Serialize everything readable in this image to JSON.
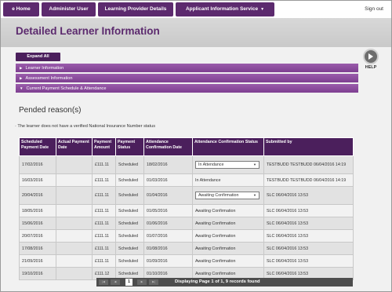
{
  "nav": {
    "tabs": [
      "e Home",
      "Administer User",
      "Learning Provider Details",
      "Applicant Information Service"
    ],
    "signout": "Sign out"
  },
  "page": {
    "title": "Detailed Learner Information"
  },
  "expand_all": "Expand All",
  "help": "HELP",
  "accordion": [
    "Learner Information",
    "Assessment Information",
    "Current Payment Schedule & Attendance"
  ],
  "pended": {
    "heading": "Pended reason(s)",
    "notice": "The learner does not have a verified National Insurance Number status"
  },
  "table": {
    "headers": [
      "Scheduled Payment Date",
      "Actual Payment Date",
      "Payment Amount",
      "Payment Status",
      "Attendance Confirmation Date",
      "Attendance Confirmation Status",
      "Submitted by"
    ],
    "rows": [
      {
        "sched": "17/02/2016",
        "actual": "",
        "amount": "£111.11",
        "status": "Scheduled",
        "conf_date": "18/02/2016",
        "conf_status": "In Attendance",
        "select": true,
        "by": "TESTBUDD TESTBUDD 06/04/2016 14:19"
      },
      {
        "sched": "16/03/2016",
        "actual": "",
        "amount": "£111.11",
        "status": "Scheduled",
        "conf_date": "01/03/2016",
        "conf_status": "In Attendance",
        "select": false,
        "by": "TESTBUDD TESTBUDD 06/04/2016 14:19"
      },
      {
        "sched": "20/04/2016",
        "actual": "",
        "amount": "£111.11",
        "status": "Scheduled",
        "conf_date": "01/04/2016",
        "conf_status": "Awaiting Confirmation",
        "select": true,
        "by": "SLC 06/04/2016 13:53"
      },
      {
        "sched": "18/05/2016",
        "actual": "",
        "amount": "£111.11",
        "status": "Scheduled",
        "conf_date": "01/05/2016",
        "conf_status": "Awaiting Confirmation",
        "select": false,
        "by": "SLC 06/04/2016 13:53"
      },
      {
        "sched": "15/06/2016",
        "actual": "",
        "amount": "£111.11",
        "status": "Scheduled",
        "conf_date": "01/06/2016",
        "conf_status": "Awaiting Confirmation",
        "select": false,
        "by": "SLC 06/04/2016 13:53"
      },
      {
        "sched": "20/07/2016",
        "actual": "",
        "amount": "£111.11",
        "status": "Scheduled",
        "conf_date": "01/07/2016",
        "conf_status": "Awaiting Confirmation",
        "select": false,
        "by": "SLC 06/04/2016 13:53"
      },
      {
        "sched": "17/08/2016",
        "actual": "",
        "amount": "£111.11",
        "status": "Scheduled",
        "conf_date": "01/08/2016",
        "conf_status": "Awaiting Confirmation",
        "select": false,
        "by": "SLC 06/04/2016 13:53"
      },
      {
        "sched": "21/09/2016",
        "actual": "",
        "amount": "£111.11",
        "status": "Scheduled",
        "conf_date": "01/09/2016",
        "conf_status": "Awaiting Confirmation",
        "select": false,
        "by": "SLC 06/04/2016 13:53"
      },
      {
        "sched": "19/10/2016",
        "actual": "",
        "amount": "£111.12",
        "status": "Scheduled",
        "conf_date": "01/10/2016",
        "conf_status": "Awaiting Confirmation",
        "select": false,
        "by": "SLC 06/04/2016 13:53"
      }
    ]
  },
  "pager": {
    "first": "|◀",
    "prev": "◀",
    "page": "1",
    "next": "▶",
    "last": "▶|",
    "info": "Displaying Page 1 of 1, 9 records found"
  }
}
